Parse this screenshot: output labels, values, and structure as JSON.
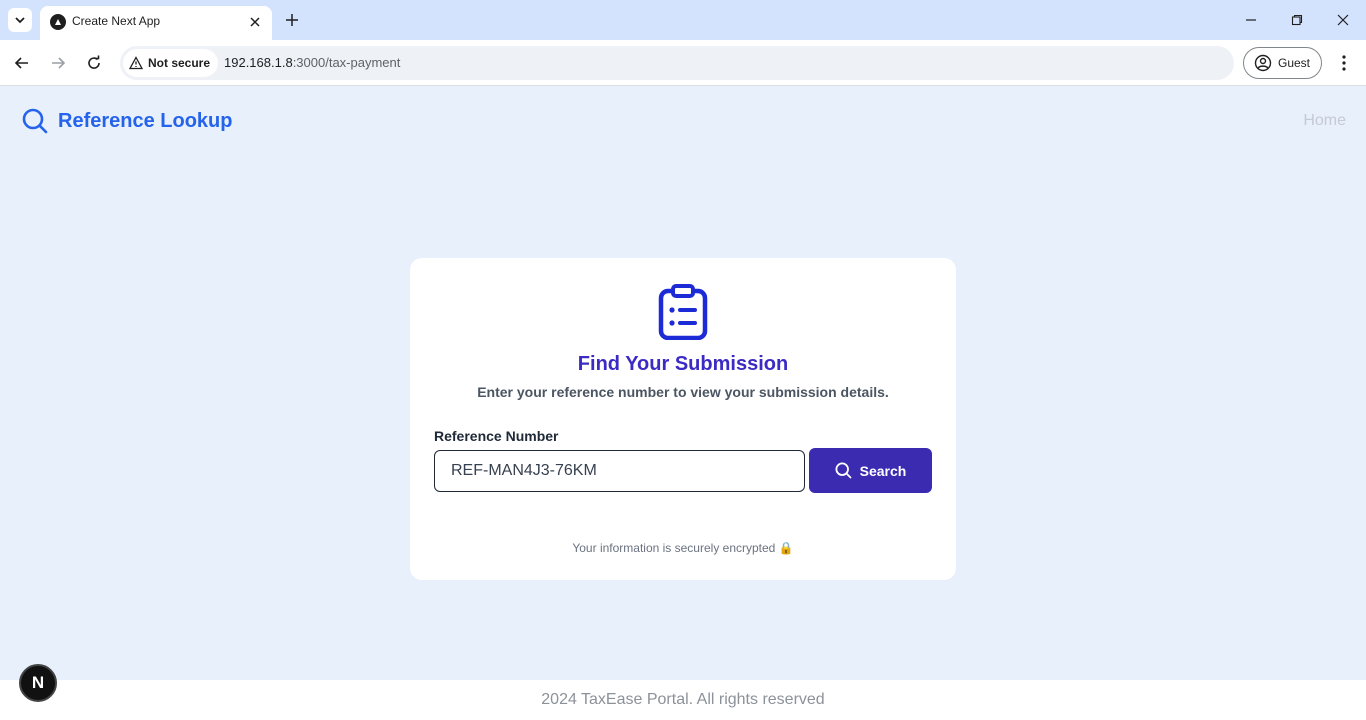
{
  "browser": {
    "tab_title": "Create Next App",
    "security_label": "Not secure",
    "url_host": "192.168.1.8",
    "url_path": ":3000/tax-payment",
    "profile_label": "Guest"
  },
  "header": {
    "brand_title": "Reference Lookup",
    "home_link": "Home"
  },
  "card": {
    "title": "Find Your Submission",
    "subtitle": "Enter your reference number to view your submission details.",
    "field_label": "Reference Number",
    "field_value": "REF-MAN4J3-76KM",
    "search_label": "Search",
    "secure_note": "Your information is securely encrypted 🔒"
  },
  "footer": {
    "text": "2024 TaxEase Portal. All rights reserved"
  },
  "dev_badge": {
    "label": "N"
  },
  "colors": {
    "brand": "#2563eb",
    "title": "#3b2bc4",
    "button": "#3b2bb0",
    "page_bg": "#e8f0fc"
  }
}
